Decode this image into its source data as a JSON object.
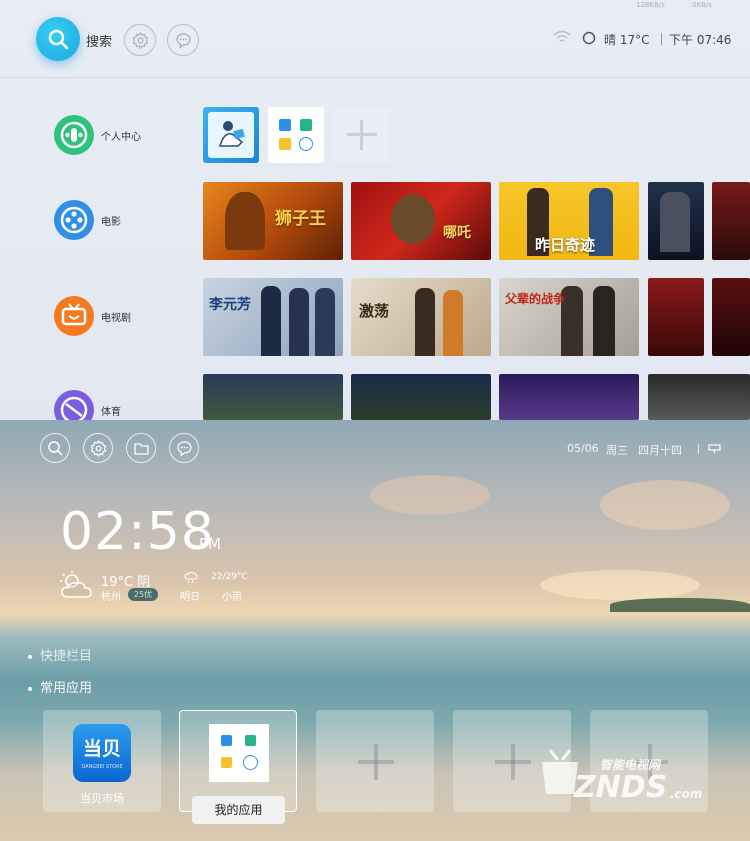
{
  "top": {
    "search_label": "搜索",
    "status_mini_left": "128KB/s",
    "status_mini_right": "0KB/s",
    "weather": "晴 17°C",
    "time": "下午 07:46",
    "sidebar": [
      {
        "label": "个人中心",
        "icon": "user-icon",
        "color": "#2fc27a"
      },
      {
        "label": "电影",
        "icon": "film-reel-icon",
        "color": "#2f8fe8"
      },
      {
        "label": "电视剧",
        "icon": "tv-icon",
        "color": "#f47a20"
      },
      {
        "label": "体育",
        "icon": "sports-icon",
        "color": "#7b5de0"
      }
    ],
    "posters_row1_titles": [
      "狮子王",
      "哪吒",
      "昨日奇迹",
      "",
      ""
    ],
    "posters_row2_titles": [
      "李元芳",
      "激荡",
      "父辈的战争",
      "",
      ""
    ]
  },
  "bottom": {
    "date": "05/06",
    "weekday": "周三",
    "lunar": "四月十四",
    "clock": "02:58",
    "ampm": "PM",
    "weather_now": "19°C 阴",
    "city": "杭州",
    "aqi": "25优",
    "forecast_range": "22/29°C",
    "forecast_day": "明日",
    "forecast_cond": "小雨",
    "section_shortcuts": "快捷栏目",
    "section_apps": "常用应用",
    "apps": [
      {
        "name": "当贝市场",
        "logo_text": "当贝",
        "logo_sub": "DANGBEI STORE"
      },
      {
        "name": "我的应用"
      }
    ],
    "watermark_cn": "智能电视网",
    "watermark_en": "ZNDS",
    "watermark_domain": ".com"
  }
}
